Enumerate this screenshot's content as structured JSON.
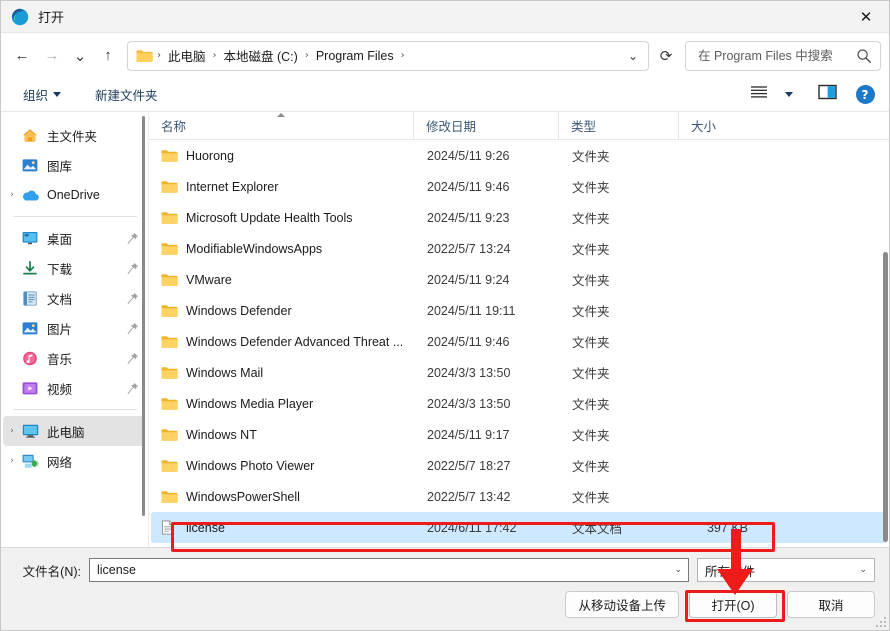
{
  "window": {
    "title": "打开",
    "app_icon": "edge-icon",
    "close_label": "✕"
  },
  "nav": {
    "back": "←",
    "forward": "→",
    "recent": "⌄",
    "up": "↑",
    "breadcrumb": [
      "此电脑",
      "本地磁盘 (C:)",
      "Program Files"
    ],
    "breadcrumb_sep": "›",
    "dropdown": "⌄",
    "refresh": "⟳"
  },
  "search": {
    "placeholder": "在 Program Files 中搜索",
    "value": "",
    "icon": "search-icon"
  },
  "commandbar": {
    "organize": "组织",
    "new_folder": "新建文件夹",
    "view_icon": "list-view-icon",
    "view_caret": "⌄",
    "preview_pane_icon": "preview-pane-icon",
    "help": "?"
  },
  "sidebar": {
    "scrollbar": true,
    "items": [
      {
        "label": "主文件夹",
        "icon": "home-icon",
        "chevron": false,
        "pin": false,
        "selected": false
      },
      {
        "label": "图库",
        "icon": "gallery-icon",
        "chevron": false,
        "pin": false,
        "selected": false
      },
      {
        "label": "OneDrive",
        "icon": "onedrive-icon",
        "chevron": true,
        "pin": false,
        "selected": false
      },
      {
        "divider": true
      },
      {
        "label": "桌面",
        "icon": "desktop-icon",
        "chevron": false,
        "pin": true,
        "selected": false
      },
      {
        "label": "下载",
        "icon": "downloads-icon",
        "chevron": false,
        "pin": true,
        "selected": false
      },
      {
        "label": "文档",
        "icon": "documents-icon",
        "chevron": false,
        "pin": true,
        "selected": false
      },
      {
        "label": "图片",
        "icon": "pictures-icon",
        "chevron": false,
        "pin": true,
        "selected": false
      },
      {
        "label": "音乐",
        "icon": "music-icon",
        "chevron": false,
        "pin": true,
        "selected": false
      },
      {
        "label": "视频",
        "icon": "videos-icon",
        "chevron": false,
        "pin": true,
        "selected": false
      },
      {
        "divider": true
      },
      {
        "label": "此电脑",
        "icon": "this-pc-icon",
        "chevron": true,
        "pin": false,
        "selected": true
      },
      {
        "label": "网络",
        "icon": "network-icon",
        "chevron": true,
        "pin": false,
        "selected": false
      }
    ]
  },
  "filelist": {
    "columns": [
      {
        "label": "名称",
        "sorted": "asc"
      },
      {
        "label": "修改日期",
        "sorted": null
      },
      {
        "label": "类型",
        "sorted": null
      },
      {
        "label": "大小",
        "sorted": null
      }
    ],
    "rows": [
      {
        "name": "Huorong",
        "date": "2024/5/11 9:26",
        "type": "文件夹",
        "size": "",
        "icon": "folder-icon",
        "selected": false
      },
      {
        "name": "Internet Explorer",
        "date": "2024/5/11 9:46",
        "type": "文件夹",
        "size": "",
        "icon": "folder-icon",
        "selected": false
      },
      {
        "name": "Microsoft Update Health Tools",
        "date": "2024/5/11 9:23",
        "type": "文件夹",
        "size": "",
        "icon": "folder-icon",
        "selected": false
      },
      {
        "name": "ModifiableWindowsApps",
        "date": "2022/5/7 13:24",
        "type": "文件夹",
        "size": "",
        "icon": "folder-icon",
        "selected": false
      },
      {
        "name": "VMware",
        "date": "2024/5/11 9:24",
        "type": "文件夹",
        "size": "",
        "icon": "folder-icon",
        "selected": false
      },
      {
        "name": "Windows Defender",
        "date": "2024/5/11 19:11",
        "type": "文件夹",
        "size": "",
        "icon": "folder-icon",
        "selected": false
      },
      {
        "name": "Windows Defender Advanced Threat ...",
        "date": "2024/5/11 9:46",
        "type": "文件夹",
        "size": "",
        "icon": "folder-icon",
        "selected": false
      },
      {
        "name": "Windows Mail",
        "date": "2024/3/3 13:50",
        "type": "文件夹",
        "size": "",
        "icon": "folder-icon",
        "selected": false
      },
      {
        "name": "Windows Media Player",
        "date": "2024/3/3 13:50",
        "type": "文件夹",
        "size": "",
        "icon": "folder-icon",
        "selected": false
      },
      {
        "name": "Windows NT",
        "date": "2024/5/11 9:17",
        "type": "文件夹",
        "size": "",
        "icon": "folder-icon",
        "selected": false
      },
      {
        "name": "Windows Photo Viewer",
        "date": "2022/5/7 18:27",
        "type": "文件夹",
        "size": "",
        "icon": "folder-icon",
        "selected": false
      },
      {
        "name": "WindowsPowerShell",
        "date": "2022/5/7 13:42",
        "type": "文件夹",
        "size": "",
        "icon": "folder-icon",
        "selected": false
      },
      {
        "name": "license",
        "date": "2024/6/11 17:42",
        "type": "文本文档",
        "size": "397 KB",
        "icon": "text-file-icon",
        "selected": true
      }
    ]
  },
  "footer": {
    "filename_label": "文件名(N):",
    "filename_value": "license",
    "filetype_value": "所有文件",
    "upload_button": "从移动设备上传",
    "open_button": "打开(O)",
    "cancel_button": "取消"
  },
  "annotations": {
    "accent_color": "#ee1b1b",
    "highlight_row": "license",
    "highlight_button": "打开(O)",
    "arrow": "red-arrow-down"
  }
}
